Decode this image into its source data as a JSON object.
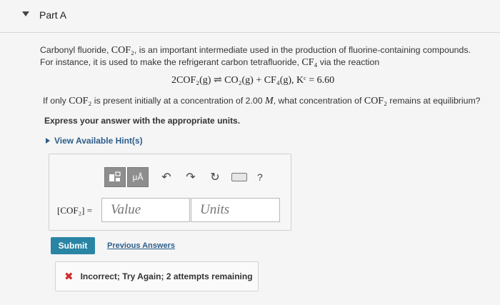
{
  "part": {
    "title": "Part A"
  },
  "problem": {
    "text_a": "Carbonyl fluoride, ",
    "formula_cof2": "COF₂",
    "text_b": ", is an important intermediate used in the production of fluorine-containing compounds. For instance, it is used to make the refrigerant carbon tetrafluoride, ",
    "formula_cf4": "CF₄",
    "text_c": " via the reaction"
  },
  "equation": "2COF₂(g) ⇌ CO₂(g) + CF₄(g),   Kᶜ = 6.60",
  "question": {
    "text_a": "If only ",
    "formula": "COF₂",
    "text_b": " is present initially at a concentration of 2.00 ",
    "unit": "M",
    "text_c": ", what concentration of ",
    "formula2": "COF₂",
    "text_d": " remains at equilibrium?"
  },
  "instruction": "Express your answer with the appropriate units.",
  "hints_label": "View Available Hint(s)",
  "toolbar": {
    "template_icon": "template-icon",
    "units_label": "μÅ",
    "undo_icon": "undo-icon",
    "redo_icon": "redo-icon",
    "reset_icon": "reset-icon",
    "keyboard_icon": "keyboard-icon",
    "help_label": "?"
  },
  "answer": {
    "lhs_label": "[COF₂] =",
    "value_placeholder": "Value",
    "units_placeholder": "Units"
  },
  "submit_label": "Submit",
  "previous_answers_label": "Previous Answers",
  "feedback": {
    "icon": "✖",
    "text": "Incorrect; Try Again; 2 attempts remaining"
  },
  "colors": {
    "accent": "#2a85a5",
    "link": "#2c5d8a",
    "error": "#cf2a2a"
  }
}
